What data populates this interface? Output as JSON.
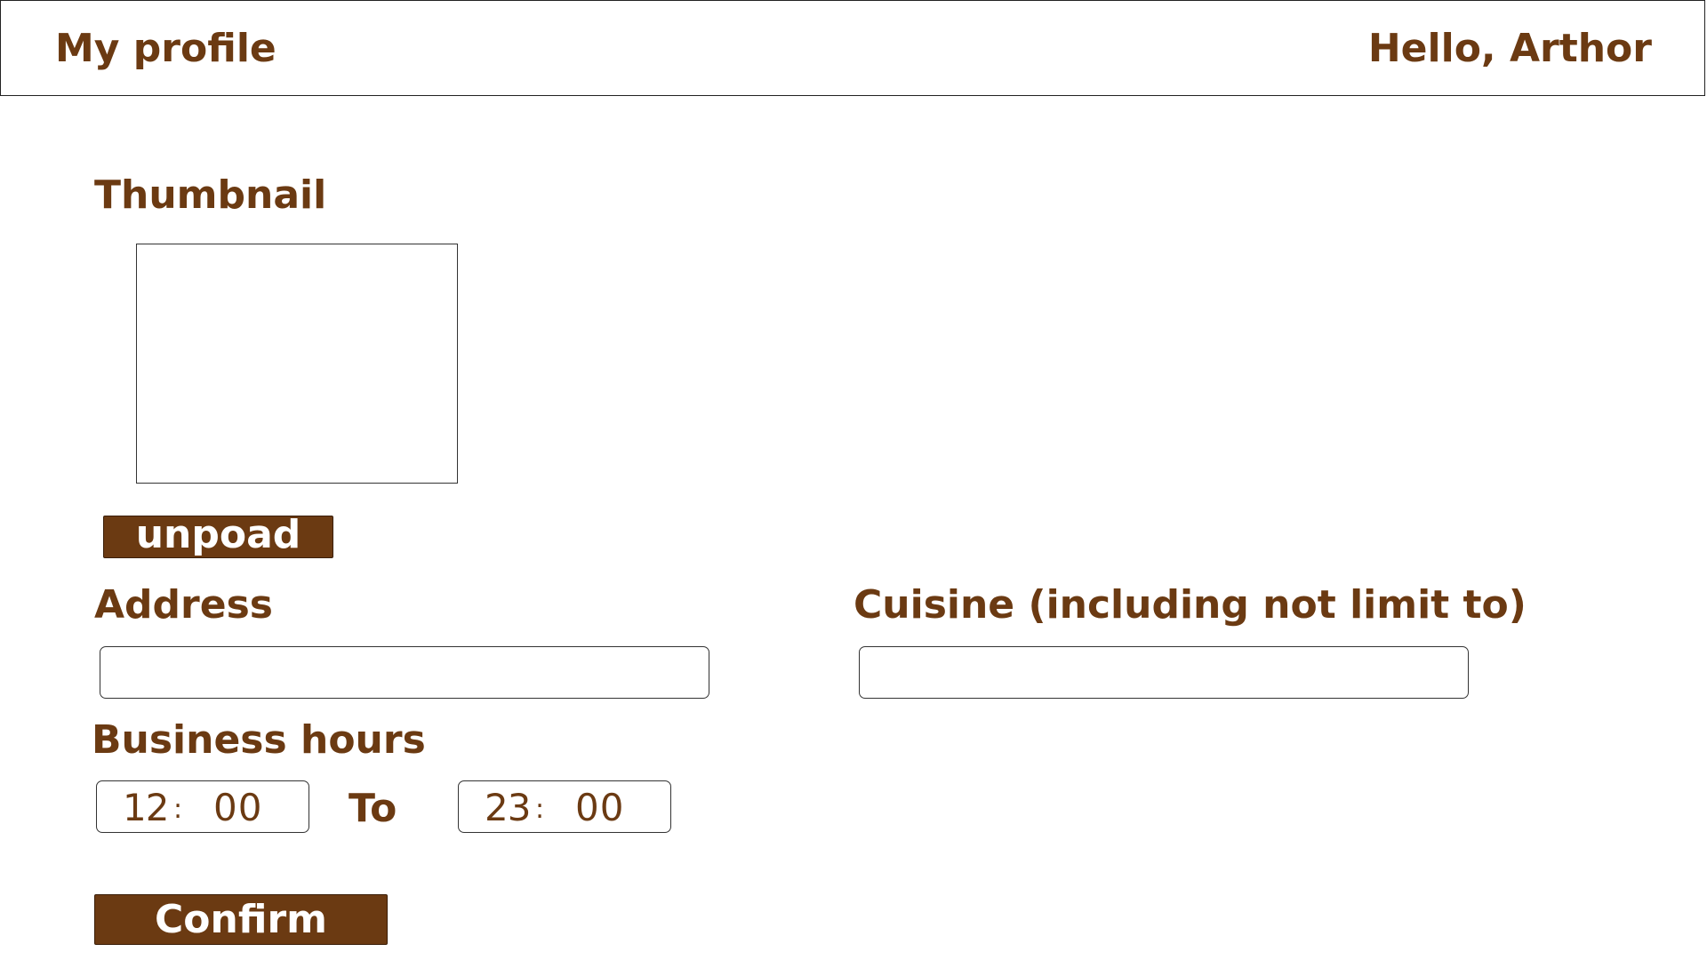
{
  "header": {
    "title": "My profile",
    "greeting": "Hello, Arthor"
  },
  "thumbnail": {
    "label": "Thumbnail",
    "upload_label": "unpoad"
  },
  "address": {
    "label": "Address",
    "value": ""
  },
  "cuisine": {
    "label": "Cuisine (including not limit to)",
    "value": ""
  },
  "business_hours": {
    "label": "Business hours",
    "from": {
      "hour": "12",
      "separator": ":",
      "minute": "00"
    },
    "to_label": "To",
    "to": {
      "hour": "23",
      "separator": ":",
      "minute": "00"
    }
  },
  "confirm_label": "Confirm",
  "colors": {
    "brand": "#6b3a12",
    "border": "#333333",
    "background": "#ffffff"
  }
}
